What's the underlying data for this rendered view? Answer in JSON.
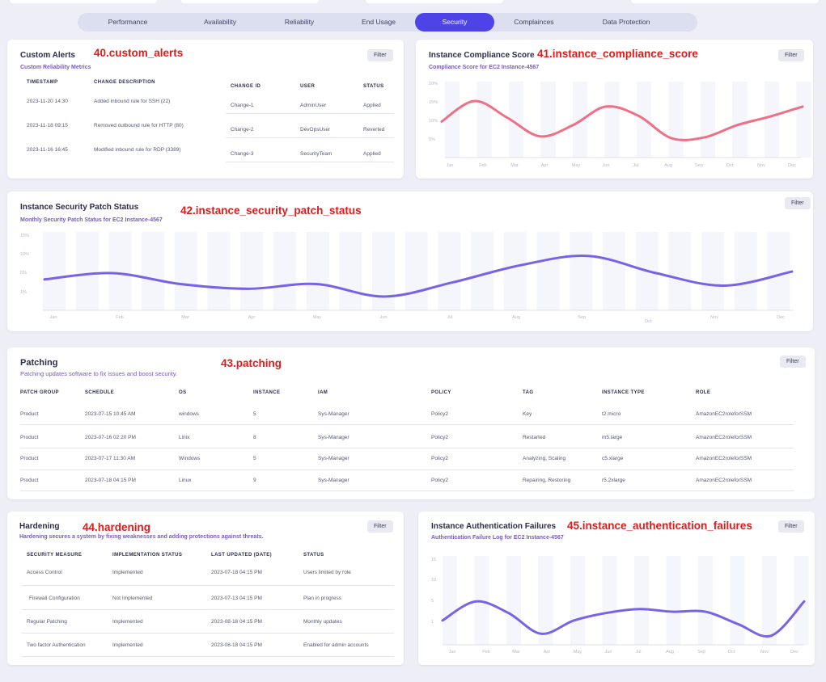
{
  "tabs": [
    "Performance",
    "Availability",
    "Reliability",
    "End Usage",
    "Security",
    "Complainces",
    "Data Protection"
  ],
  "active_tab": "Security",
  "filter_label": "Filter",
  "custom_alerts": {
    "tag": "40.custom_alerts",
    "title": "Custom Alerts",
    "subtitle": "Custom Reliability Metrics",
    "columns": [
      "TIMESTAMP",
      "CHANGE DESCRIPTION",
      "CHANGE ID",
      "USER",
      "STATUS"
    ],
    "rows": [
      [
        "2023-11-20 14:30",
        "Added inbound rule for SSH (22)",
        "Change-1",
        "AdminUser",
        "Applied"
      ],
      [
        "2023-11-18 09:15",
        "Removed outbound rule for HTTP (80)",
        "Change-2",
        "DevOpsUser",
        "Reverted"
      ],
      [
        "2023-11-16 16:45",
        "Modified inbound rule for RDP (3389)",
        "Change-3",
        "SecurityTeam",
        "Applied"
      ]
    ]
  },
  "instance_compliance_score": {
    "tag": "41.instance_compliance_score",
    "title": "Instance Compliance Score",
    "subtitle": "Compliance Score for EC2 Instance-4567",
    "accent_color": "#ef6f86",
    "chart_data": {
      "type": "line",
      "categories": [
        "Jan",
        "Feb",
        "Mar",
        "Apr",
        "May",
        "Jun",
        "Jul",
        "Aug",
        "Sep",
        "Oct",
        "Nov",
        "Dec"
      ],
      "y_ticks": [
        "20%",
        "15%",
        "10%",
        "5%"
      ],
      "ylim": [
        0,
        20
      ],
      "values": [
        9.5,
        15,
        10.5,
        5.5,
        8.5,
        13.5,
        11,
        5,
        5.2,
        8.5,
        10.8,
        13.5
      ],
      "grid": "vertical bars"
    }
  },
  "instance_security_patch_status": {
    "tag": "42.instance_security_patch_status",
    "title": "Instance Security Patch Status",
    "subtitle": "Monthly Security Patch Status for EC2 Instance-4567",
    "accent_color": "#7a62e6",
    "chart_data": {
      "type": "line",
      "categories": [
        "Jan",
        "Feb",
        "Mar",
        "Apr",
        "May",
        "Jun",
        "Jul",
        "Aug",
        "Sep",
        "Oct",
        "Nov",
        "Dec"
      ],
      "y_ticks": [
        "15%",
        "10%",
        "5%",
        "1%"
      ],
      "ylim": [
        0,
        15
      ],
      "values": [
        5.5,
        7.5,
        4,
        2.5,
        4,
        0,
        4.5,
        10,
        13,
        7.5,
        3.5,
        8
      ],
      "grid": "vertical bars"
    }
  },
  "patching": {
    "tag": "43.patching",
    "title": "Patching",
    "subtitle": "Patching updates software to fix issues and boost security.",
    "columns": [
      "PATCH GROUP",
      "SCHEDULE",
      "OS",
      "INSTANCE",
      "IAM",
      "POLICY",
      "TAG",
      "INSTANCE TYPE",
      "ROLE"
    ],
    "rows": [
      [
        "Product",
        "2023-07-15 10:45 AM",
        "windows",
        "5",
        "Sys-Manager",
        "Policy2",
        "Key",
        "t2.micro",
        "AmazonEC2roleforSSM"
      ],
      [
        "Product",
        "2023-07-16 02:20 PM",
        "Linix",
        "8",
        "Sys-Manager",
        "Policy2",
        "Restarted",
        "m5.large",
        "AmazonEC2roleforSSM"
      ],
      [
        "Product",
        "2023-07-17 11:30 AM",
        "Windows",
        "5",
        "Sys-Manager",
        "Policy2",
        "Analyzing, Scaling",
        "c5.xlarge",
        "AmazonEC2roleforSSM"
      ],
      [
        "Product",
        "2023-07-18 04:15 PM",
        "Linux",
        "9",
        "Sys-Manager",
        "Policy2",
        "Repairing, Restoring",
        "r5.2xlarge",
        "AmazonEC2roleforSSM"
      ]
    ]
  },
  "hardening": {
    "tag": "44.hardening",
    "title": "Hardening",
    "subtitle": "Hardening secures a system by fixing weaknesses and adding protections against threats.",
    "columns": [
      "SECURITY MEASURE",
      "IMPLEMENTATION STATUS",
      "LAST UPDATED (DATE)",
      "STATUS"
    ],
    "rows": [
      [
        "Access Control",
        "Implemented",
        "2023-07-18 04:15 PM",
        "Users limited by role"
      ],
      [
        "Firewall Configuration",
        "Not Implemented",
        "2023-07-13 04:15 PM",
        "Plan in progress"
      ],
      [
        "Regular Patching",
        "Implemented",
        "2023-08-18 04:15 PM",
        "Monthly updates"
      ],
      [
        "Two factor Authentication",
        "Implemented",
        "2023-08-18 04:15 PM",
        "Enabled for admin accounts"
      ]
    ]
  },
  "instance_authentication_failures": {
    "tag": "45.instance_authentication_failures",
    "title": "Instance Authentication Failures",
    "subtitle": "Authentication Failure Log for EC2 Instance-4567",
    "accent_color": "#7a62e6",
    "chart_data": {
      "type": "line",
      "categories": [
        "Jan",
        "Feb",
        "Mar",
        "Apr",
        "May",
        "Jun",
        "Jul",
        "Aug",
        "Sep",
        "Oct",
        "Nov",
        "Dec"
      ],
      "y_ticks": [
        "15",
        "10",
        "5",
        "1"
      ],
      "ylim": [
        0,
        20
      ],
      "values": [
        4.5,
        9.5,
        6.5,
        1,
        4.5,
        6.5,
        7.5,
        6.8,
        6.8,
        3.5,
        0.5,
        9.5
      ],
      "grid": "vertical bars"
    }
  }
}
